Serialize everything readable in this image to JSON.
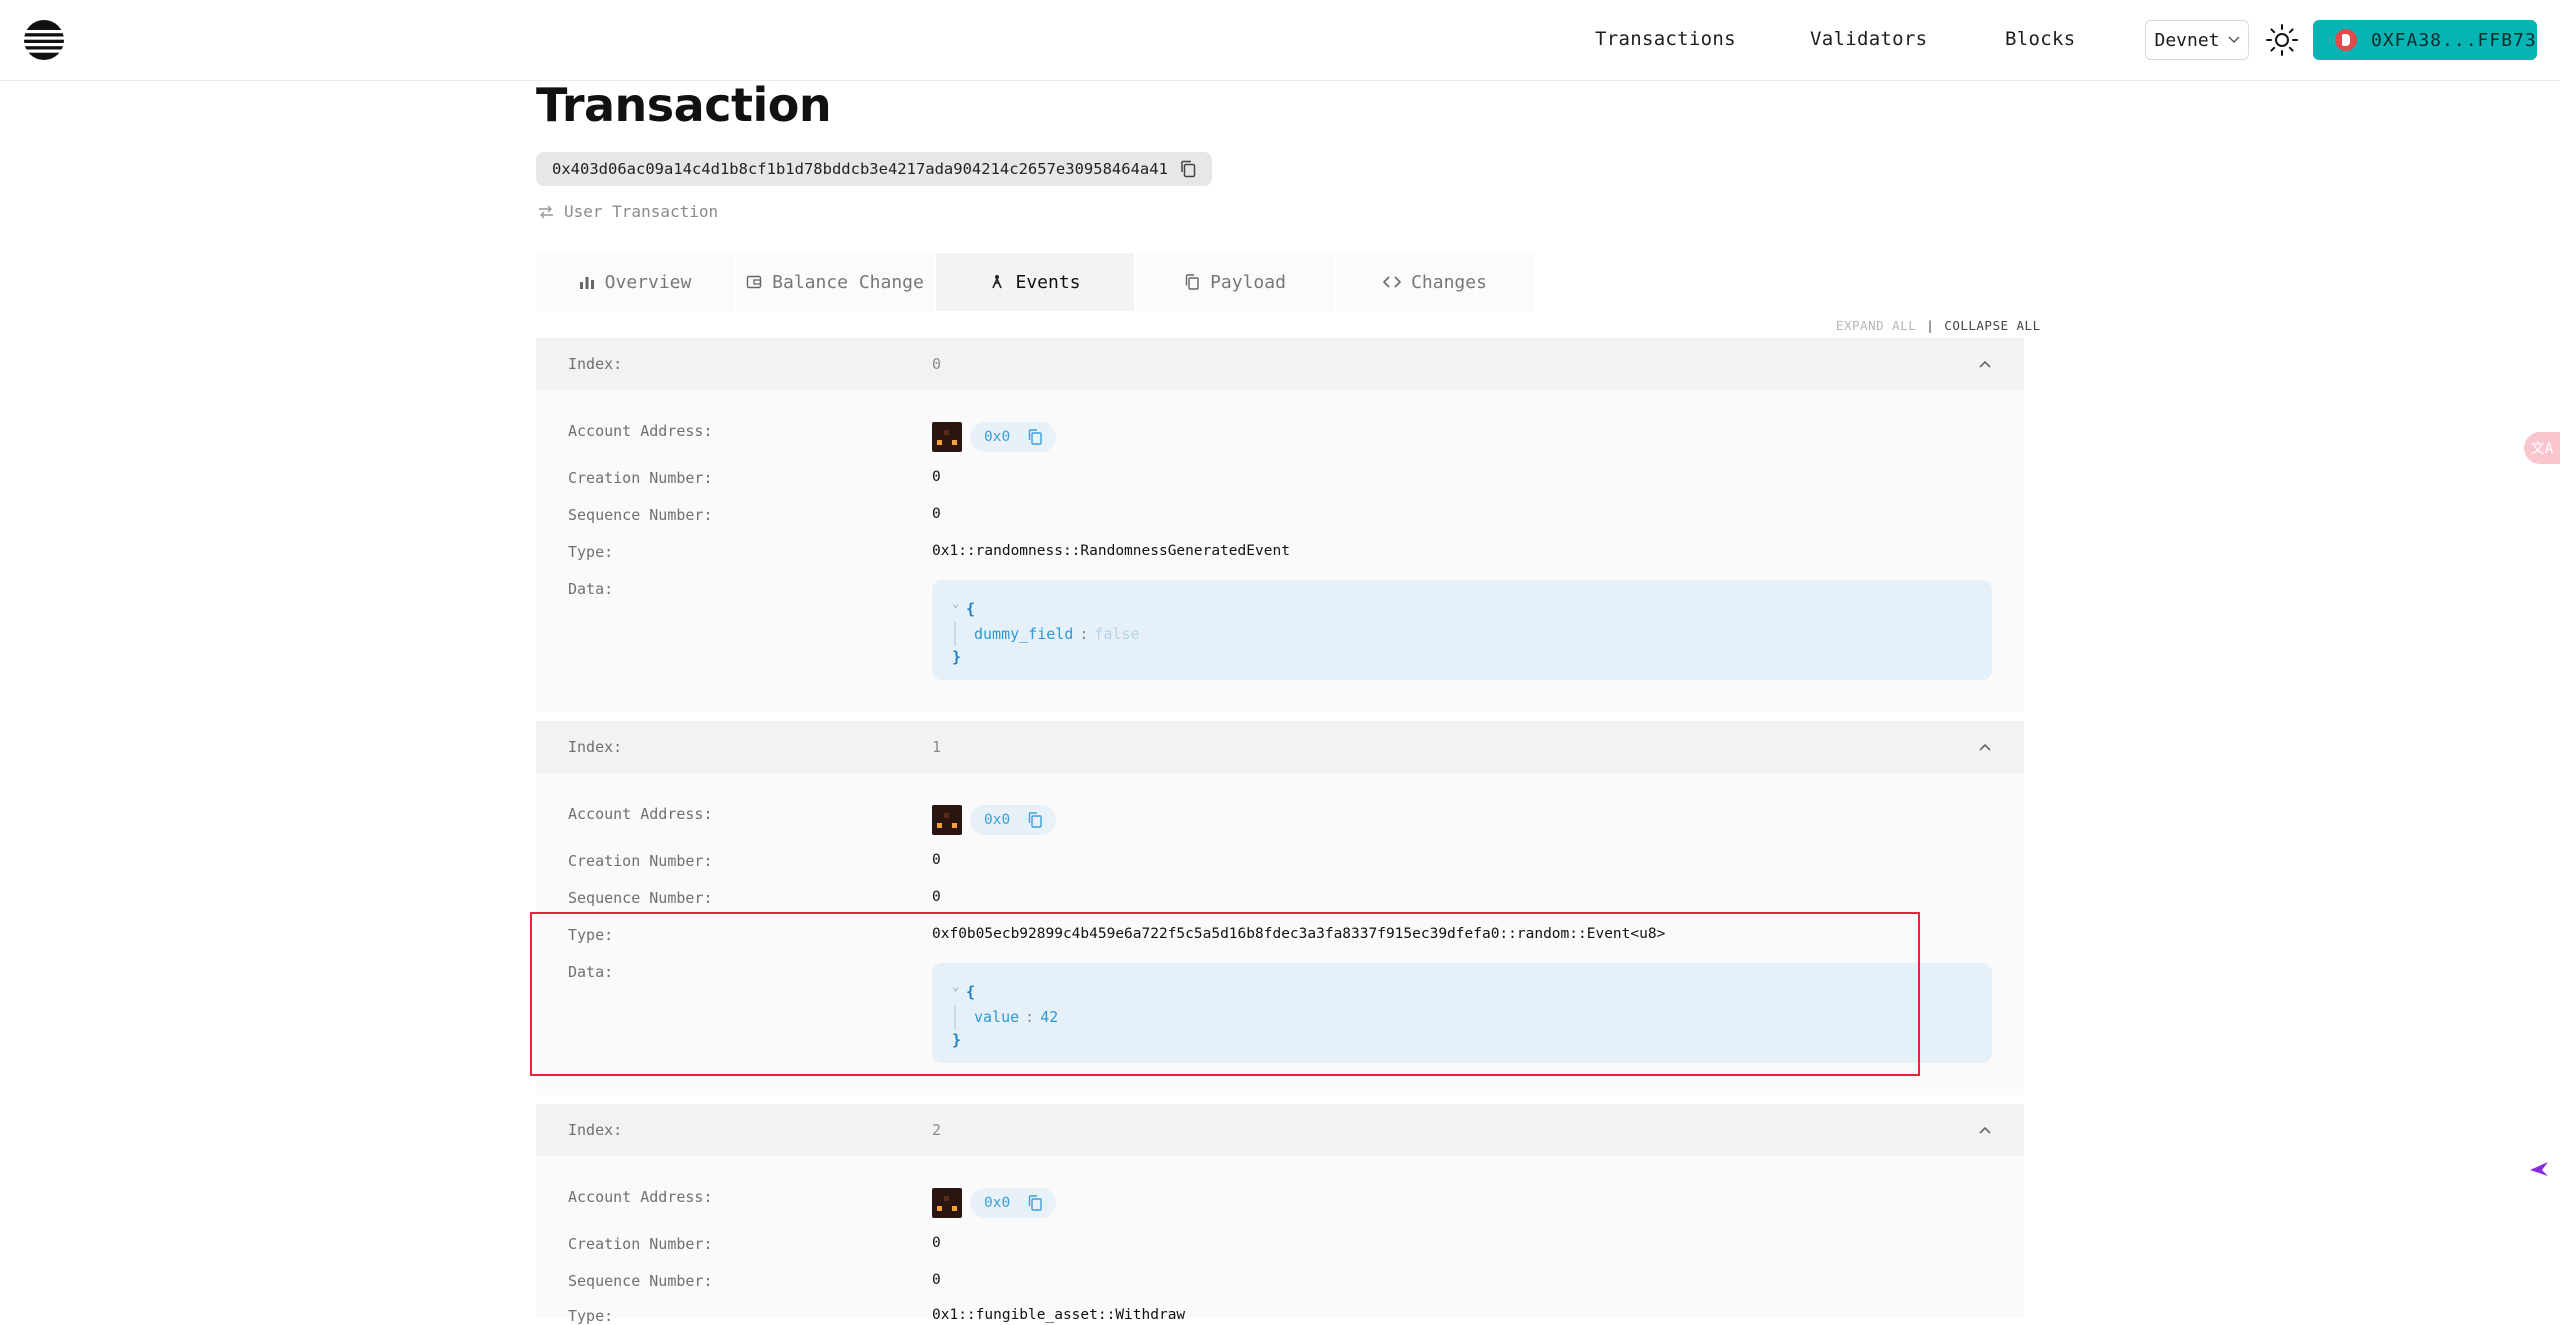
{
  "header": {
    "nav": [
      "Transactions",
      "Validators",
      "Blocks"
    ],
    "network": "Devnet",
    "wallet_address": "0XFA38...FFB73",
    "brand_color": "#06b4b4"
  },
  "page": {
    "title": "Transaction",
    "hash": "0x403d06ac09a14c4d1b8cf1b1d78bddcb3e4217ada904214c2657e30958464a41",
    "tx_type": "User Transaction"
  },
  "tabs": [
    {
      "label": "Overview",
      "icon": "bar-chart-icon"
    },
    {
      "label": "Balance Change",
      "icon": "wallet-icon"
    },
    {
      "label": "Events",
      "icon": "events-icon",
      "active": true
    },
    {
      "label": "Payload",
      "icon": "copy-file-icon"
    },
    {
      "label": "Changes",
      "icon": "code-icon"
    }
  ],
  "controls": {
    "expand_all": "EXPAND ALL",
    "separator": "|",
    "collapse_all": "COLLAPSE ALL"
  },
  "labels": {
    "index": "Index:",
    "account_address": "Account Address:",
    "creation_number": "Creation Number:",
    "sequence_number": "Sequence Number:",
    "type": "Type:",
    "data": "Data:"
  },
  "json_syntax": {
    "open": "{",
    "close": "}",
    "colon": ":"
  },
  "events": [
    {
      "index": "0",
      "account_address": "0x0",
      "creation_number": "0",
      "sequence_number": "0",
      "type": "0x1::randomness::RandomnessGeneratedEvent",
      "data_key": "dummy_field",
      "data_value": "false"
    },
    {
      "index": "1",
      "account_address": "0x0",
      "creation_number": "0",
      "sequence_number": "0",
      "type": "0xf0b05ecb92899c4b459e6a722f5c5a5d16b8fdec3a3fa8337f915ec39dfefa0::random::Event<u8>",
      "data_key": "value",
      "data_value": "42"
    },
    {
      "index": "2",
      "account_address": "0x0",
      "creation_number": "0",
      "sequence_number": "0",
      "type": "0x1::fungible_asset::Withdraw"
    }
  ],
  "side": {
    "translate_label": "文A"
  }
}
